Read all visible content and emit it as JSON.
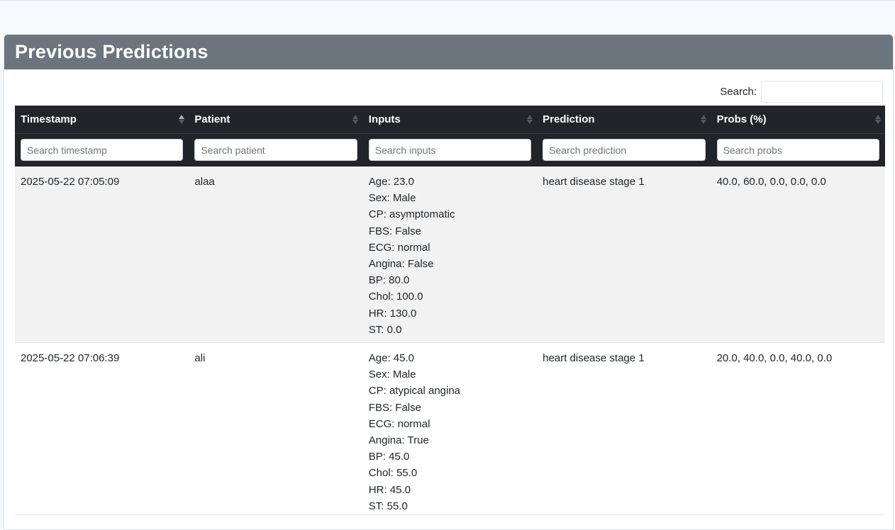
{
  "page": {
    "title": "Previous Predictions"
  },
  "search": {
    "label": "Search:",
    "value": ""
  },
  "table": {
    "columns": [
      {
        "label": "Timestamp",
        "filter_placeholder": "Search timestamp",
        "sorted": "asc"
      },
      {
        "label": "Patient",
        "filter_placeholder": "Search patient",
        "sorted": "none"
      },
      {
        "label": "Inputs",
        "filter_placeholder": "Search inputs",
        "sorted": "none"
      },
      {
        "label": "Prediction",
        "filter_placeholder": "Search prediction",
        "sorted": "none"
      },
      {
        "label": "Probs (%)",
        "filter_placeholder": "Search probs",
        "sorted": "none"
      }
    ],
    "rows": [
      {
        "timestamp": "2025-05-22 07:05:09",
        "patient": "alaa",
        "inputs": [
          "Age: 23.0",
          "Sex: Male",
          "CP: asymptomatic",
          "FBS: False",
          "ECG: normal",
          "Angina: False",
          "BP: 80.0",
          "Chol: 100.0",
          "HR: 130.0",
          "ST: 0.0"
        ],
        "prediction": "heart disease stage 1",
        "probs": "40.0, 60.0, 0.0, 0.0, 0.0"
      },
      {
        "timestamp": "2025-05-22 07:06:39",
        "patient": "ali",
        "inputs": [
          "Age: 45.0",
          "Sex: Male",
          "CP: atypical angina",
          "FBS: False",
          "ECG: normal",
          "Angina: True",
          "BP: 45.0",
          "Chol: 55.0",
          "HR: 45.0",
          "ST: 55.0"
        ],
        "prediction": "heart disease stage 1",
        "probs": "20.0, 40.0, 0.0, 40.0, 0.0"
      }
    ]
  },
  "colors": {
    "header_bg": "#6c757d",
    "table_head_bg": "#212529",
    "striped_row_bg": "#f2f2f2"
  }
}
